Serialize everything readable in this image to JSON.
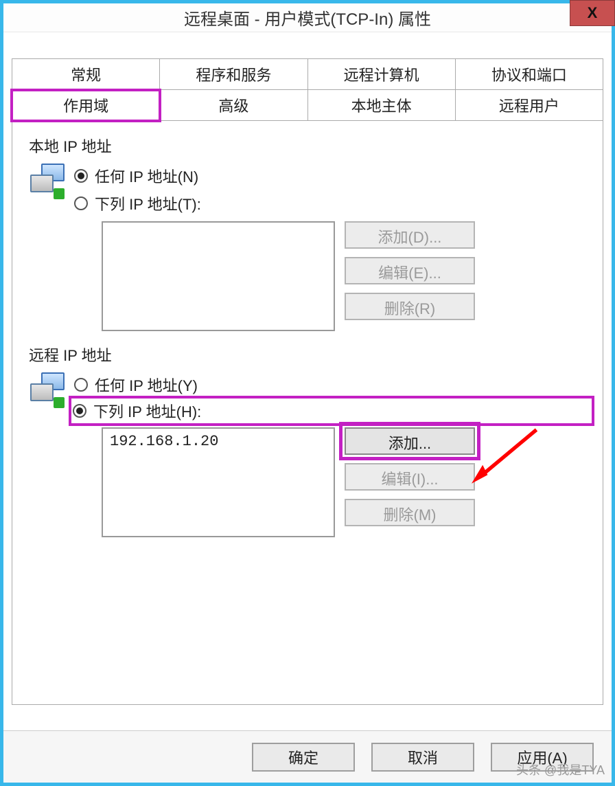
{
  "window": {
    "title": "远程桌面 - 用户模式(TCP-In) 属性",
    "close": "X"
  },
  "tabs": {
    "row1": [
      "常规",
      "程序和服务",
      "远程计算机",
      "协议和端口"
    ],
    "row2": [
      "作用域",
      "高级",
      "本地主体",
      "远程用户"
    ],
    "active": "作用域"
  },
  "local": {
    "title": "本地 IP 地址",
    "any": "任何 IP 地址(N)",
    "these": "下列 IP 地址(T):",
    "add": "添加(D)...",
    "edit": "编辑(E)...",
    "remove": "删除(R)",
    "selected": "any",
    "items": []
  },
  "remote": {
    "title": "远程 IP 地址",
    "any": "任何 IP 地址(Y)",
    "these": "下列 IP 地址(H):",
    "add": "添加...",
    "edit": "编辑(I)...",
    "remove": "删除(M)",
    "selected": "these",
    "items": [
      "192.168.1.20"
    ]
  },
  "buttons": {
    "ok": "确定",
    "cancel": "取消",
    "apply": "应用(A)"
  },
  "watermark": "头条 @我是TYA"
}
